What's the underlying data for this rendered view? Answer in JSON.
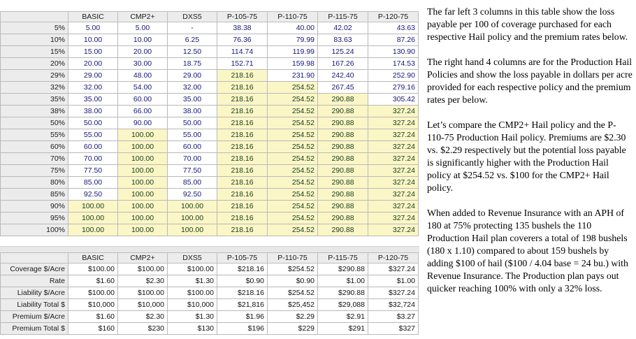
{
  "columns": [
    "BASIC",
    "CMP2+",
    "DXS5",
    "P-105-75",
    "P-110-75",
    "P-115-75",
    "P-120-75"
  ],
  "loss_table": {
    "rows": [
      {
        "label": "5%",
        "values": [
          "5.00",
          "5.00",
          "-",
          "38.38",
          "40.00",
          "42.02",
          "43.63"
        ],
        "hl": [
          0,
          0,
          0,
          0,
          0,
          0,
          0
        ]
      },
      {
        "label": "10%",
        "values": [
          "10.00",
          "10.00",
          "6.25",
          "76.36",
          "79.99",
          "83.63",
          "87.26"
        ],
        "hl": [
          0,
          0,
          0,
          0,
          0,
          0,
          0
        ]
      },
      {
        "label": "15%",
        "values": [
          "15.00",
          "20.00",
          "12.50",
          "114.74",
          "119.99",
          "125.24",
          "130.90"
        ],
        "hl": [
          0,
          0,
          0,
          0,
          0,
          0,
          0
        ]
      },
      {
        "label": "20%",
        "values": [
          "20.00",
          "30.00",
          "18.75",
          "152.71",
          "159.98",
          "167.26",
          "174.53"
        ],
        "hl": [
          0,
          0,
          0,
          0,
          0,
          0,
          0
        ]
      },
      {
        "label": "29%",
        "values": [
          "29.00",
          "48.00",
          "29.00",
          "218.16",
          "231.90",
          "242.40",
          "252.90"
        ],
        "hl": [
          0,
          0,
          0,
          1,
          0,
          0,
          0
        ]
      },
      {
        "label": "32%",
        "values": [
          "32.00",
          "54.00",
          "32.00",
          "218.16",
          "254.52",
          "267.45",
          "279.16"
        ],
        "hl": [
          0,
          0,
          0,
          1,
          1,
          0,
          0
        ]
      },
      {
        "label": "35%",
        "values": [
          "35.00",
          "60.00",
          "35.00",
          "218.16",
          "254.52",
          "290.88",
          "305.42"
        ],
        "hl": [
          0,
          0,
          0,
          1,
          1,
          1,
          0
        ]
      },
      {
        "label": "38%",
        "values": [
          "38.00",
          "66.00",
          "38.00",
          "218.16",
          "254.52",
          "290.88",
          "327.24"
        ],
        "hl": [
          0,
          0,
          0,
          1,
          1,
          1,
          1
        ]
      },
      {
        "label": "50%",
        "values": [
          "50.00",
          "90.00",
          "50.00",
          "218.16",
          "254.52",
          "290.88",
          "327.24"
        ],
        "hl": [
          0,
          0,
          0,
          1,
          1,
          1,
          1
        ]
      },
      {
        "label": "55%",
        "values": [
          "55.00",
          "100.00",
          "55.00",
          "218.16",
          "254.52",
          "290.88",
          "327.24"
        ],
        "hl": [
          0,
          1,
          0,
          1,
          1,
          1,
          1
        ]
      },
      {
        "label": "60%",
        "values": [
          "60.00",
          "100.00",
          "60.00",
          "218.16",
          "254.52",
          "290.88",
          "327.24"
        ],
        "hl": [
          0,
          1,
          0,
          1,
          1,
          1,
          1
        ]
      },
      {
        "label": "70%",
        "values": [
          "70.00",
          "100.00",
          "70.00",
          "218.16",
          "254.52",
          "290.88",
          "327.24"
        ],
        "hl": [
          0,
          1,
          0,
          1,
          1,
          1,
          1
        ]
      },
      {
        "label": "75%",
        "values": [
          "77.50",
          "100.00",
          "77.50",
          "218.16",
          "254.52",
          "290.88",
          "327.24"
        ],
        "hl": [
          0,
          1,
          0,
          1,
          1,
          1,
          1
        ]
      },
      {
        "label": "80%",
        "values": [
          "85.00",
          "100.00",
          "85.00",
          "218.16",
          "254.52",
          "290.88",
          "327.24"
        ],
        "hl": [
          0,
          1,
          0,
          1,
          1,
          1,
          1
        ]
      },
      {
        "label": "85%",
        "values": [
          "92.50",
          "100.00",
          "92.50",
          "218.16",
          "254.52",
          "290.88",
          "327.24"
        ],
        "hl": [
          0,
          1,
          0,
          1,
          1,
          1,
          1
        ]
      },
      {
        "label": "90%",
        "values": [
          "100.00",
          "100.00",
          "100.00",
          "218.16",
          "254.52",
          "290.88",
          "327.24"
        ],
        "hl": [
          1,
          1,
          1,
          1,
          1,
          1,
          1
        ]
      },
      {
        "label": "95%",
        "values": [
          "100.00",
          "100.00",
          "100.00",
          "218.16",
          "254.52",
          "290.88",
          "327.24"
        ],
        "hl": [
          1,
          1,
          1,
          1,
          1,
          1,
          1
        ]
      },
      {
        "label": "100%",
        "values": [
          "100.00",
          "100.00",
          "100.00",
          "218.16",
          "254.52",
          "290.88",
          "327.24"
        ],
        "hl": [
          1,
          1,
          1,
          1,
          1,
          1,
          1
        ]
      }
    ]
  },
  "premium_table": {
    "rows": [
      {
        "label": "Coverage $/Acre",
        "values": [
          "$100.00",
          "$100.00",
          "$100.00",
          "$218.16",
          "$254.52",
          "$290.88",
          "$327.24"
        ]
      },
      {
        "label": "Rate",
        "values": [
          "$1.60",
          "$2.30",
          "$1.30",
          "$0.90",
          "$0.90",
          "$1.00",
          "$1.00"
        ]
      },
      {
        "label": "Liability $/Acre",
        "values": [
          "$100.00",
          "$100.00",
          "$100.00",
          "$218.16",
          "$254.52",
          "$290.88",
          "$327.24"
        ]
      },
      {
        "label": "Liability Total $",
        "values": [
          "$10,000",
          "$10,000",
          "$10,000",
          "$21,816",
          "$25,452",
          "$29,088",
          "$32,724"
        ]
      },
      {
        "label": "Premium $/Acre",
        "values": [
          "$1.60",
          "$2.30",
          "$1.30",
          "$1.96",
          "$2.29",
          "$2.91",
          "$3.27"
        ]
      },
      {
        "label": "Premium Total $",
        "values": [
          "$160",
          "$230",
          "$130",
          "$196",
          "$229",
          "$291",
          "$327"
        ]
      }
    ]
  },
  "notes": [
    "The far left 3 columns in this table show the loss payable per 100 of coverage purchased for each respective Hail policy and the premium rates below.",
    "The right hand 4 columns are for the Production Hail Policies and show the loss payable in dollars per acre provided for each respective policy and the premium rates per below.",
    "Let’s compare the CMP2+ Hail policy and the P-110-75 Production Hail policy. Premiums are $2.30 vs. $2.29 respectively but the potential loss payable is  significantly higher with the Production Hail policy at $254.52 vs. $100 for the CMP2+ Hail policy.",
    "When added to Revenue Insurance with an APH of 180 at 75% protecting 135 bushels the 110 Production Hail plan coverers a total of 198 bushels (180 x 1.10)  compared to about 159 bushels by adding $100 of hail ($100 / 4.04 base = 24 bu.) with Revenue Insurance. The Production plan pays out quicker reaching 100% with only a 32% loss."
  ]
}
